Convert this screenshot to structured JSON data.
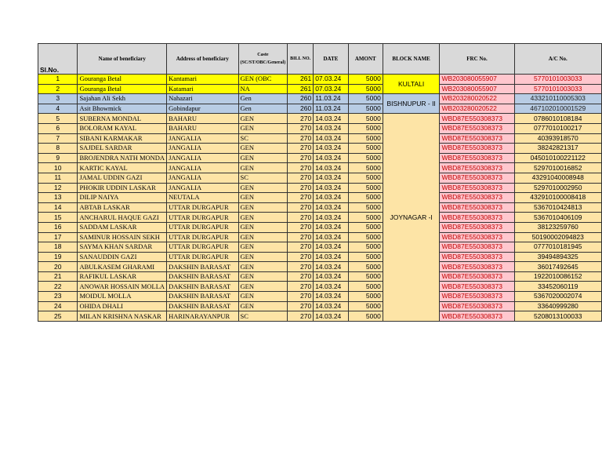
{
  "headers": {
    "sl": "Sl.No.",
    "name": "Name of beneficiary",
    "address": "Address of beneficiary",
    "caste": "Caste (SC/ST/OBC/General)",
    "bill": "BILL NO.",
    "date": "DATE",
    "amount": "AMONT",
    "block": "BLOCK NAME",
    "frc": "FRC No.",
    "ac": "A/C No."
  },
  "blocks": [
    {
      "name": "KULTALI",
      "rows": 2,
      "color": "yellow"
    },
    {
      "name": "BISHNUPUR - II",
      "rows": 2,
      "color": "blue"
    },
    {
      "name": "JOYNAGAR -I",
      "rows": 21,
      "color": "orange"
    }
  ],
  "rows": [
    {
      "sl": "1",
      "name": "Gouranga Betal",
      "address": "Kantamari",
      "caste": "GEN (OBC",
      "bill": "261",
      "date": "07.03.24",
      "amount": "5000",
      "frc": "WB203080055907",
      "ac": "5770101003033"
    },
    {
      "sl": "2",
      "name": "Gouranga Betal",
      "address": "Katamari",
      "caste": "NA",
      "bill": "261",
      "date": "07.03.24",
      "amount": "5000",
      "frc": "WB203080055907",
      "ac": "5770101003033"
    },
    {
      "sl": "3",
      "name": "Sajahan Ali Sekh",
      "address": "Nahazari",
      "caste": "Gen",
      "bill": "260",
      "date": "11.03.24",
      "amount": "5000",
      "frc": "WB203280020522",
      "ac": "433210110005303"
    },
    {
      "sl": "4",
      "name": "Asit Bhowmick",
      "address": "Gobindapur",
      "caste": "Gen",
      "bill": "260",
      "date": "11.03.24",
      "amount": "5000",
      "frc": "WB203280020522",
      "ac": "467102010001529"
    },
    {
      "sl": "5",
      "name": "SUBERNA MONDAL",
      "address": "BAHARU",
      "caste": "GEN",
      "bill": "270",
      "date": "14.03.24",
      "amount": "5000",
      "frc": "WBD87E550308373",
      "ac": "0786010108184"
    },
    {
      "sl": "6",
      "name": "BOLORAM KAYAL",
      "address": "BAHARU",
      "caste": "GEN",
      "bill": "270",
      "date": "14.03.24",
      "amount": "5000",
      "frc": "WBD87E550308373",
      "ac": "0777010100217"
    },
    {
      "sl": "7",
      "name": "SIBANI KARMAKAR",
      "address": "JANGALIA",
      "caste": "SC",
      "bill": "270",
      "date": "14.03.24",
      "amount": "5000",
      "frc": "WBD87E550308373",
      "ac": "40393918570"
    },
    {
      "sl": "8",
      "name": "SAJDEL SARDAR",
      "address": "JANGALIA",
      "caste": "GEN",
      "bill": "270",
      "date": "14.03.24",
      "amount": "5000",
      "frc": "WBD87E550308373",
      "ac": "38242821317"
    },
    {
      "sl": "9",
      "name": "BROJENDRA NATH MONDA",
      "address": "JANGALIA",
      "caste": "GEN",
      "bill": "270",
      "date": "14.03.24",
      "amount": "5000",
      "frc": "WBD87E550308373",
      "ac": "045010100221122"
    },
    {
      "sl": "10",
      "name": "KARTIC KAYAL",
      "address": "JANGALIA",
      "caste": "GEN",
      "bill": "270",
      "date": "14.03.24",
      "amount": "5000",
      "frc": "WBD87E550308373",
      "ac": "5297010016852"
    },
    {
      "sl": "11",
      "name": "JAMAL UDDIN GAZI",
      "address": "JANGALIA",
      "caste": "SC",
      "bill": "270",
      "date": "14.03.24",
      "amount": "5000",
      "frc": "WBD87E550308373",
      "ac": "43291040008948"
    },
    {
      "sl": "12",
      "name": "PHOKIR UDDIN LASKAR",
      "address": "JANGALIA",
      "caste": "GEN",
      "bill": "270",
      "date": "14.03.24",
      "amount": "5000",
      "frc": "WBD87E550308373",
      "ac": "5297010002950"
    },
    {
      "sl": "13",
      "name": "DILIP NAIYA",
      "address": "NEUTALA",
      "caste": "GEN",
      "bill": "270",
      "date": "14.03.24",
      "amount": "5000",
      "frc": "WBD87E550308373",
      "ac": "432910100008418"
    },
    {
      "sl": "14",
      "name": "ABTAB LASKAR",
      "address": "UTTAR DURGAPUR",
      "caste": "GEN",
      "bill": "270",
      "date": "14.03.24",
      "amount": "5000",
      "frc": "WBD87E550308373",
      "ac": "5367010424813"
    },
    {
      "sl": "15",
      "name": "ANCHARUL HAQUE GAZI",
      "address": "UTTAR DURGAPUR",
      "caste": "GEN",
      "bill": "270",
      "date": "14.03.24",
      "amount": "5000",
      "frc": "WBD87E550308373",
      "ac": "5367010406109"
    },
    {
      "sl": "16",
      "name": "SADDAM LASKAR",
      "address": "UTTAR DURGAPUR",
      "caste": "GEN",
      "bill": "270",
      "date": "14.03.24",
      "amount": "5000",
      "frc": "WBD87E550308373",
      "ac": "38123259760"
    },
    {
      "sl": "17",
      "name": "SAMINUR HOSSAIN SEKH",
      "address": "UTTAR DURGAPUR",
      "caste": "GEN",
      "bill": "270",
      "date": "14.03.24",
      "amount": "5000",
      "frc": "WBD87E550308373",
      "ac": "50190002094823"
    },
    {
      "sl": "18",
      "name": "SAYMA KHAN SARDAR",
      "address": "UTTAR DURGAPUR",
      "caste": "GEN",
      "bill": "270",
      "date": "14.03.24",
      "amount": "5000",
      "frc": "WBD87E550308373",
      "ac": "0777010181945"
    },
    {
      "sl": "19",
      "name": "SANAUDDIN GAZI",
      "address": "UTTAR DURGAPUR",
      "caste": "GEN",
      "bill": "270",
      "date": "14.03.24",
      "amount": "5000",
      "frc": "WBD87E550308373",
      "ac": "39494894325"
    },
    {
      "sl": "20",
      "name": "ABULKASEM GHARAMI",
      "address": "DAKSHIN BARASAT",
      "caste": "GEN",
      "bill": "270",
      "date": "14.03.24",
      "amount": "5000",
      "frc": "WBD87E550308373",
      "ac": "36017492645"
    },
    {
      "sl": "21",
      "name": "RAFIKUL LASKAR",
      "address": "DAKSHIN BARASAT",
      "caste": "GEN",
      "bill": "270",
      "date": "14.03.24",
      "amount": "5000",
      "frc": "WBD87E550308373",
      "ac": "1922010086152"
    },
    {
      "sl": "22",
      "name": "ANOWAR HOSSAIN MOLLA",
      "address": "DAKSHIN BARASAT",
      "caste": "GEN",
      "bill": "270",
      "date": "14.03.24",
      "amount": "5000",
      "frc": "WBD87E550308373",
      "ac": "33452060119"
    },
    {
      "sl": "23",
      "name": "MOIDUL MOLLA",
      "address": "DAKSHIN BARASAT",
      "caste": "GEN",
      "bill": "270",
      "date": "14.03.24",
      "amount": "5000",
      "frc": "WBD87E550308373",
      "ac": "5367020002074"
    },
    {
      "sl": "24",
      "name": "OHIDA DHALI",
      "address": "DAKSHIN BARASAT",
      "caste": "GEN",
      "bill": "270",
      "date": "14.03.24",
      "amount": "5000",
      "frc": "WBD87E550308373",
      "ac": "33640999280"
    },
    {
      "sl": "25",
      "name": "MILAN KRISHNA NASKAR",
      "address": "HARINARAYANPUR",
      "caste": "SC",
      "bill": "270",
      "date": "14.03.24",
      "amount": "5000",
      "frc": "WBD87E550308373",
      "ac": "5208013100033"
    }
  ]
}
